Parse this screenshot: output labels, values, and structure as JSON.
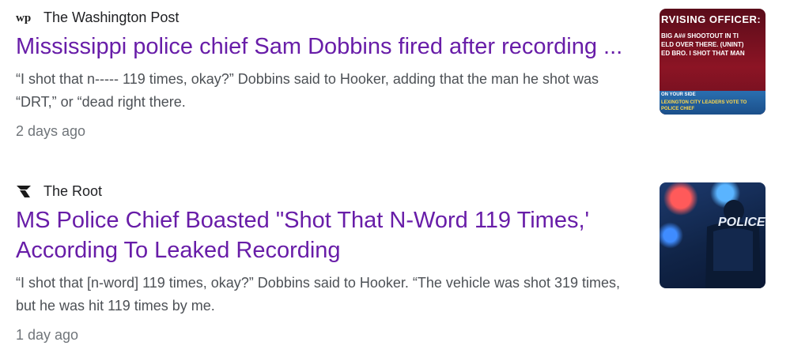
{
  "results": [
    {
      "source_name": "The Washington Post",
      "source_logo": "wp",
      "title": "Mississippi police chief Sam Dobbins fired after recording ...",
      "snippet": "“I shot that n----- 119 times, okay?” Dobbins said to Hooker, adding that the man he shot was “DRT,” or “dead right there.",
      "age": "2 days ago",
      "thumbnail": {
        "headline": "RVISING OFFICER:",
        "line1": "BIG A## SHOOTOUT IN TI",
        "line2": "ELD OVER THERE. (UNINT)",
        "line3": "ED BRO. I SHOT THAT MAN",
        "band_line1": "ON YOUR SIDE",
        "band_line2": "LEXINGTON CITY LEADERS VOTE TO",
        "band_line3": "POLICE CHIEF"
      }
    },
    {
      "source_name": "The Root",
      "source_logo": "root-logo-icon",
      "title": "MS Police Chief Boasted \"Shot That N-Word 119 Times,' According To Leaked Recording",
      "snippet": "“I shot that [n-word] 119 times, okay?” Dobbins said to Hooker. “The vehicle was shot 319 times, but he was hit 119 times by me.",
      "age": "1 day ago",
      "thumbnail": {
        "text": "POLICE"
      }
    }
  ],
  "colors": {
    "title_link": "#681da8",
    "snippet": "#4d5156",
    "age": "#70757a"
  }
}
